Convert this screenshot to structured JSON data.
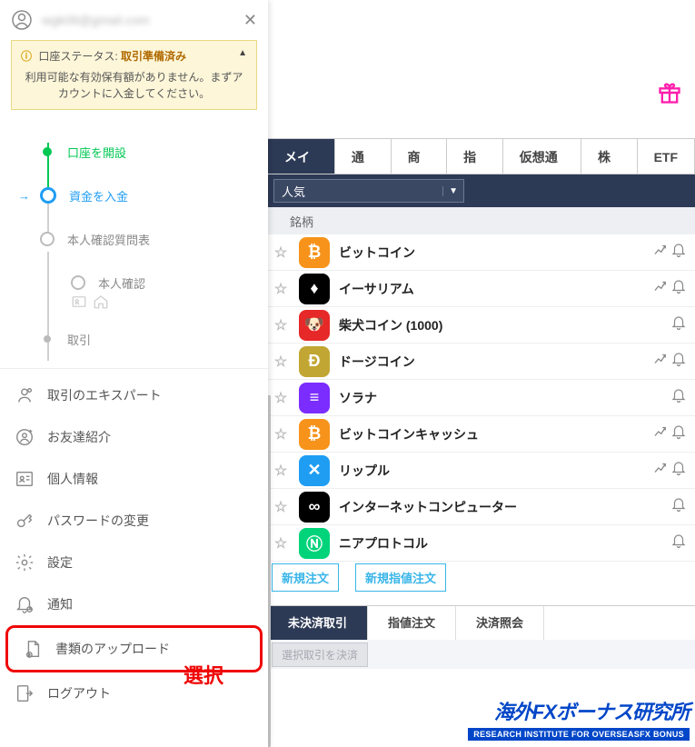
{
  "user_email": "wgk08@gmail.com",
  "status": {
    "label_prefix": "口座ステータス:",
    "value": "取引準備済み",
    "message": "利用可能な有効保有額がありません。まずアカウントに入金してください。"
  },
  "steps": {
    "open_account": "口座を開設",
    "deposit": "資金を入金",
    "questionnaire": "本人確認質問表",
    "identity": "本人確認",
    "trade": "取引"
  },
  "menu": {
    "expert": "取引のエキスパート",
    "refer": "お友達紹介",
    "profile": "個人情報",
    "password": "パスワードの変更",
    "settings": "設定",
    "notifications": "通知",
    "upload": "書類のアップロード",
    "logout": "ログアウト"
  },
  "annotation": "選択",
  "tabs": [
    "メイン",
    "通貨",
    "商品",
    "指数",
    "仮想通貨",
    "株式",
    "ETF"
  ],
  "filter_label": "人気",
  "column_header": "銘柄",
  "instruments": [
    {
      "name": "ビットコイン",
      "bg": "#f7931a",
      "glyph": "₿",
      "chart": true
    },
    {
      "name": "イーサリアム",
      "bg": "#000000",
      "glyph": "♦",
      "chart": true
    },
    {
      "name": "柴犬コイン (1000)",
      "bg": "#e62828",
      "glyph": "🐶",
      "chart": false
    },
    {
      "name": "ドージコイン",
      "bg": "#c2a633",
      "glyph": "Ð",
      "chart": true
    },
    {
      "name": "ソラナ",
      "bg": "#7b2cff",
      "glyph": "≡",
      "chart": false
    },
    {
      "name": "ビットコインキャッシュ",
      "bg": "#f7931a",
      "glyph": "₿",
      "chart": true
    },
    {
      "name": "リップル",
      "bg": "#1e9df3",
      "glyph": "✕",
      "chart": true
    },
    {
      "name": "インターネットコンピューター",
      "bg": "#000000",
      "glyph": "∞",
      "chart": false
    },
    {
      "name": "ニアプロトコル",
      "bg": "#00d37a",
      "glyph": "Ⓝ",
      "chart": false
    }
  ],
  "order_buttons": {
    "new": "新規注文",
    "new_limit": "新規指値注文"
  },
  "sub_tabs": [
    "未決済取引",
    "指値注文",
    "決済照会"
  ],
  "close_selected": "選択取引を決済",
  "footer": {
    "jp": "海外FXボーナス研究所",
    "en": "RESEARCH INSTITUTE FOR OVERSEASFX BONUS"
  }
}
